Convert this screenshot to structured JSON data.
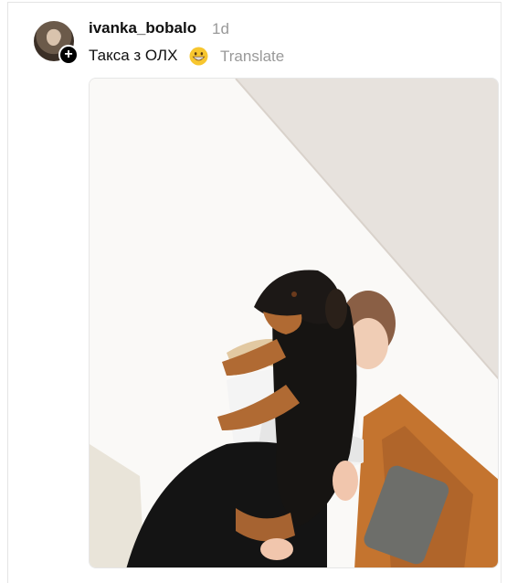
{
  "post": {
    "username": "ivanka_bobalo",
    "time": "1d",
    "caption": "Такса з ОЛХ",
    "translate_label": "Translate",
    "follow_icon": "plus-icon",
    "emoji_icon": "grinning-face-emoji-icon"
  }
}
